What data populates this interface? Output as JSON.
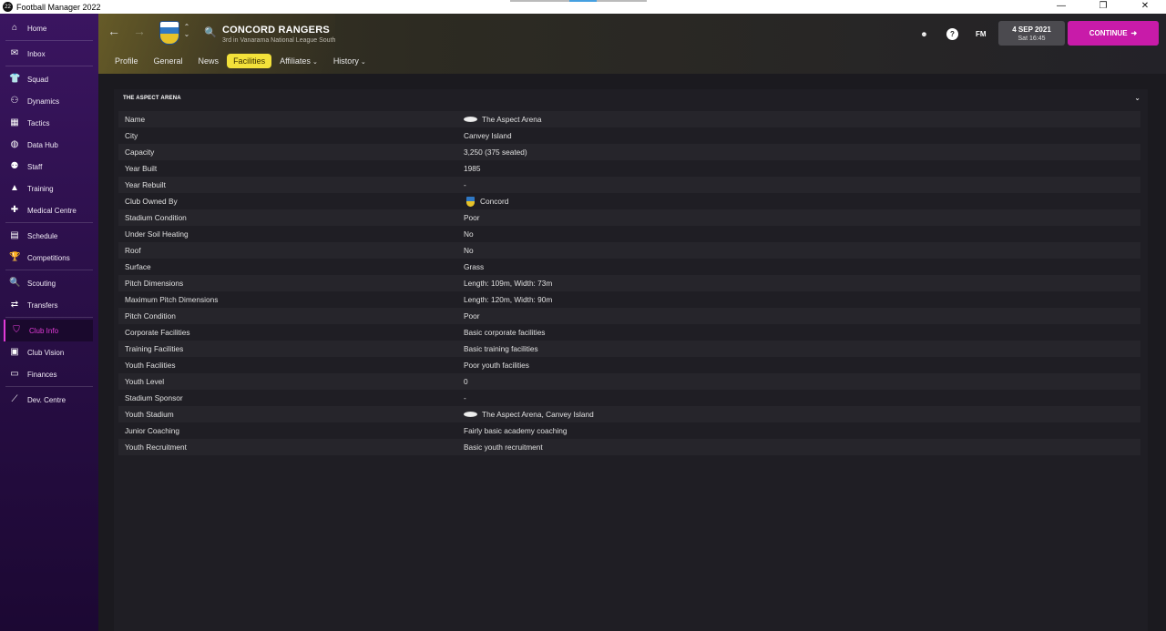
{
  "window": {
    "title": "Football Manager 2022",
    "app_icon_text": "22",
    "minimize": "—",
    "restore": "❐",
    "close": "✕"
  },
  "sidebar": {
    "items": [
      {
        "label": "Home",
        "icon": "house-icon",
        "glyph": "⌂"
      },
      {
        "label": "Inbox",
        "icon": "inbox-icon",
        "glyph": "✉"
      },
      {
        "label": "Squad",
        "icon": "shirt-icon",
        "glyph": "👕"
      },
      {
        "label": "Dynamics",
        "icon": "people-icon",
        "glyph": "⚇"
      },
      {
        "label": "Tactics",
        "icon": "tactics-board-icon",
        "glyph": "▦"
      },
      {
        "label": "Data Hub",
        "icon": "data-hub-icon",
        "glyph": "◍"
      },
      {
        "label": "Staff",
        "icon": "staff-icon",
        "glyph": "⚉"
      },
      {
        "label": "Training",
        "icon": "training-cone-icon",
        "glyph": "▲"
      },
      {
        "label": "Medical Centre",
        "icon": "medical-kit-icon",
        "glyph": "✚"
      },
      {
        "label": "Schedule",
        "icon": "calendar-icon",
        "glyph": "▤"
      },
      {
        "label": "Competitions",
        "icon": "trophy-icon",
        "glyph": "🏆"
      },
      {
        "label": "Scouting",
        "icon": "magnifier-icon",
        "glyph": "🔍"
      },
      {
        "label": "Transfers",
        "icon": "transfer-arrows-icon",
        "glyph": "⇄"
      },
      {
        "label": "Club Info",
        "icon": "shield-icon",
        "glyph": "⛉"
      },
      {
        "label": "Club Vision",
        "icon": "briefcase-icon",
        "glyph": "▣"
      },
      {
        "label": "Finances",
        "icon": "money-icon",
        "glyph": "▭"
      },
      {
        "label": "Dev. Centre",
        "icon": "dev-centre-icon",
        "glyph": "⟋"
      }
    ]
  },
  "header": {
    "back": "←",
    "forward": "→",
    "updown": "⌃⌄",
    "club_name": "CONCORD RANGERS",
    "club_sub": "3rd in Vanarama National League South",
    "tabs": [
      {
        "label": "Profile",
        "chevron": ""
      },
      {
        "label": "General",
        "chevron": ""
      },
      {
        "label": "News",
        "chevron": ""
      },
      {
        "label": "Facilities",
        "chevron": ""
      },
      {
        "label": "Affiliates",
        "chevron": "⌄"
      },
      {
        "label": "History",
        "chevron": "⌄"
      }
    ],
    "fm_label": "FM",
    "help_glyph": "?",
    "date": "4 SEP 2021",
    "time": "Sat 16:45",
    "continue_label": "CONTINUE",
    "continue_glyph": "➜"
  },
  "panel": {
    "title": "THE ASPECT ARENA",
    "chevron": "⌄",
    "rows": [
      {
        "label": "Name",
        "value": "The Aspect Arena"
      },
      {
        "label": "City",
        "value": "Canvey Island"
      },
      {
        "label": "Capacity",
        "value": "3,250 (375 seated)"
      },
      {
        "label": "Year Built",
        "value": "1985"
      },
      {
        "label": "Year Rebuilt",
        "value": "-"
      },
      {
        "label": "Club Owned By",
        "value": "Concord"
      },
      {
        "label": "Stadium Condition",
        "value": "Poor"
      },
      {
        "label": "Under Soil Heating",
        "value": "No"
      },
      {
        "label": "Roof",
        "value": "No"
      },
      {
        "label": "Surface",
        "value": "Grass"
      },
      {
        "label": "Pitch Dimensions",
        "value": "Length: 109m, Width: 73m"
      },
      {
        "label": "Maximum Pitch Dimensions",
        "value": "Length: 120m, Width: 90m"
      },
      {
        "label": "Pitch Condition",
        "value": "Poor"
      },
      {
        "label": "Corporate Facilities",
        "value": "Basic corporate facilities"
      },
      {
        "label": "Training Facilities",
        "value": "Basic training facilities"
      },
      {
        "label": "Youth Facilities",
        "value": "Poor youth facilities"
      },
      {
        "label": "Youth Level",
        "value": "0"
      },
      {
        "label": "Stadium Sponsor",
        "value": "-"
      },
      {
        "label": "Youth Stadium",
        "value": "The Aspect Arena, Canvey Island"
      },
      {
        "label": "Junior Coaching",
        "value": "Fairly basic academy coaching"
      },
      {
        "label": "Youth Recruitment",
        "value": "Basic youth recruitment"
      }
    ]
  },
  "colors": {
    "accent_magenta": "#c81ba9",
    "active_tab_yellow": "#f3e13a",
    "sidebar_purple": "#3a1560"
  }
}
